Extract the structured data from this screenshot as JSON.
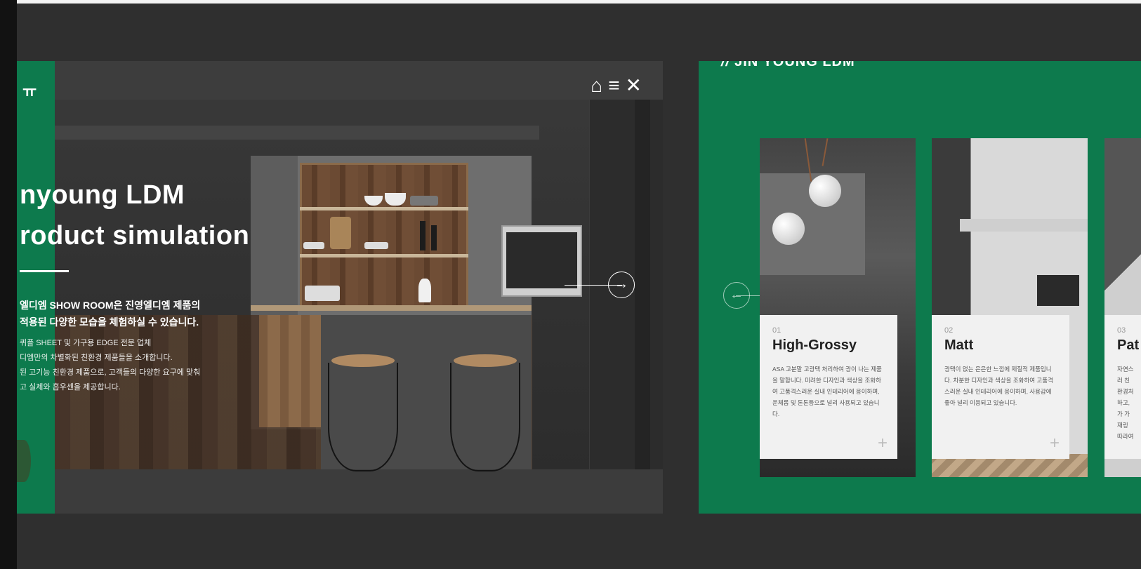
{
  "left_slide": {
    "strip_logo": "ㅠ",
    "title_line1": "nyoung LDM",
    "title_line2": "roduct simulation",
    "desc_line1": "엘디엠 SHOW ROOM은 진영엘디엠 제품의",
    "desc_line2": "적용된 다양한 모습을 체험하실 수 있습니다.",
    "desc_small1": "퀴플 SHEET 및 가구용 EDGE 전문 업체",
    "desc_small2": "디엠만의 차별화된 친환경 제품들을 소개합니다.",
    "desc_small3": "된 고기능 친환경 제품으로, 고객들의 다양한 요구에 맞춰",
    "desc_small4": "고 실제와 흡우센을 제공합니다.",
    "home_icon": "⌂",
    "menu_icon": "≡",
    "close_icon": "✕",
    "next_arrow": "→"
  },
  "right_slide": {
    "logo": "JIN YOUNG LDM",
    "logo_mark": "//",
    "prev_arrow": "←",
    "cards": [
      {
        "num": "01",
        "name": "High-Grossy",
        "text": "ASA 고분말 고광택 처리하여 광이 나는 제품을 말합니다. 미려한 디자인과 색상을 조화하여 고품격스러운 실내 인테리어에 응이하며, 운체롭 및 톤톤등으로 널리 사용되고 있습니다.",
        "plus": "+"
      },
      {
        "num": "02",
        "name": "Matt",
        "text": "광택이 없는 은은한 느낌에 제질적 제품입니다. 차분한 디자인과 색상을 조화하여 고품격스러운 실내 인테리어에 응이하며, 사용감에 좋아 널리 이용되고 있습니다.",
        "plus": "+"
      },
      {
        "num": "03",
        "name": "Pat",
        "text": "자연스러 친환경처 하고, 가 가재링 따라여",
        "plus": "+"
      }
    ]
  }
}
